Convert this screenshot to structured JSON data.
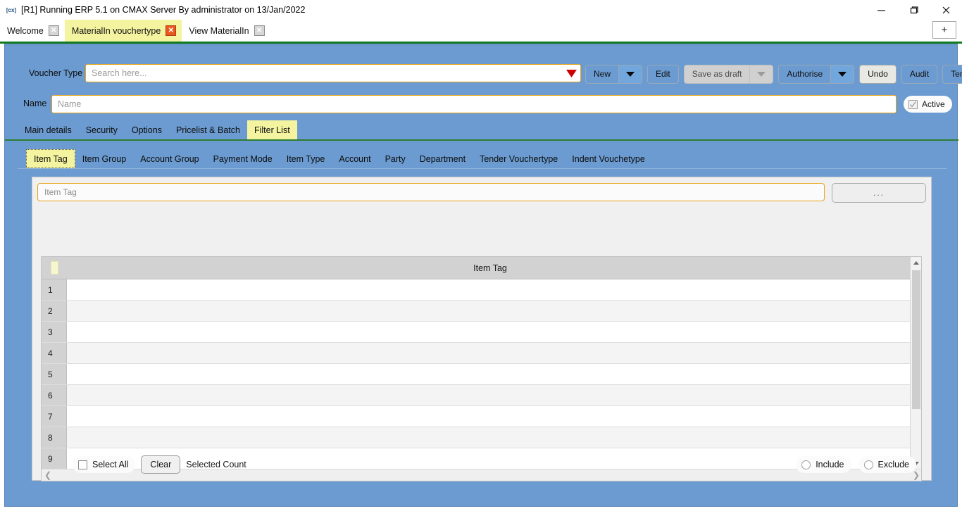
{
  "window": {
    "title": "[R1] Running ERP 5.1 on CMAX Server By administrator on 13/Jan/2022",
    "app_icon": "cmax-icon",
    "minimize_label": "—",
    "maximize_label": "❐",
    "close_label": "✕"
  },
  "tabs": {
    "items": [
      {
        "label": "Welcome",
        "active": false,
        "close": "✕"
      },
      {
        "label": "MaterialIn vouchertype",
        "active": true,
        "close": "✕"
      },
      {
        "label": "View MaterialIn",
        "active": false,
        "close": "✕"
      }
    ],
    "new_tab_label": "+"
  },
  "form": {
    "voucher_type_label": "Voucher Type",
    "voucher_type_placeholder": "Search here...",
    "voucher_type_value": "",
    "name_label": "Name",
    "name_placeholder": "Name",
    "name_value": "",
    "active_label": "Active",
    "active_checked": true
  },
  "toolbar": {
    "new_label": "New",
    "edit_label": "Edit",
    "save_as_draft_label": "Save as draft",
    "authorise_label": "Authorise",
    "undo_label": "Undo",
    "audit_label": "Audit",
    "template_label": "Template"
  },
  "main_tabs": [
    {
      "label": "Main details",
      "active": false
    },
    {
      "label": "Security",
      "active": false
    },
    {
      "label": "Options",
      "active": false
    },
    {
      "label": "Pricelist & Batch",
      "active": false
    },
    {
      "label": "Filter List",
      "active": true
    }
  ],
  "sub_tabs": [
    {
      "label": "Item Tag",
      "active": true
    },
    {
      "label": "Item Group",
      "active": false
    },
    {
      "label": "Account Group",
      "active": false
    },
    {
      "label": "Payment Mode",
      "active": false
    },
    {
      "label": "Item Type",
      "active": false
    },
    {
      "label": "Account",
      "active": false
    },
    {
      "label": "Party",
      "active": false
    },
    {
      "label": "Department",
      "active": false
    },
    {
      "label": "Tender Vouchertype",
      "active": false
    },
    {
      "label": "Indent Vouchetype",
      "active": false
    }
  ],
  "filter_panel": {
    "search_placeholder": "Item Tag",
    "search_value": "",
    "ellipsis_label": "...",
    "grid": {
      "column_header": "Item Tag",
      "rows": [
        {
          "n": "1",
          "value": ""
        },
        {
          "n": "2",
          "value": ""
        },
        {
          "n": "3",
          "value": ""
        },
        {
          "n": "4",
          "value": ""
        },
        {
          "n": "5",
          "value": ""
        },
        {
          "n": "6",
          "value": ""
        },
        {
          "n": "7",
          "value": ""
        },
        {
          "n": "8",
          "value": ""
        },
        {
          "n": "9",
          "value": ""
        }
      ]
    },
    "select_all_label": "Select All",
    "clear_label": "Clear",
    "selected_count_label": "Selected Count",
    "include_label": "Include",
    "exclude_label": "Exclude"
  },
  "colors": {
    "form_blue": "#6b9bd0",
    "accent_yellow": "#f4f4a0",
    "green_rule": "#127a1f",
    "field_border_orange": "#e8a317",
    "red_caret": "#cc0000"
  }
}
